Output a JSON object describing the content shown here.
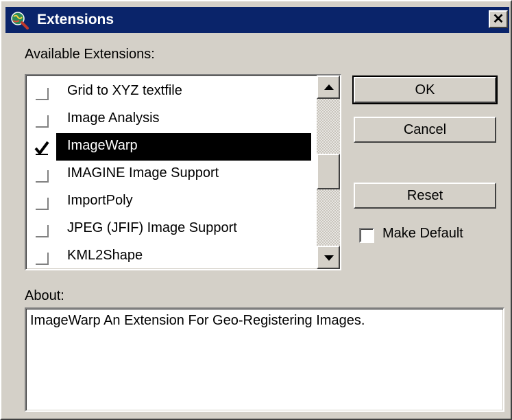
{
  "window": {
    "title": "Extensions",
    "close_label": "✕"
  },
  "available_label": "Available Extensions:",
  "extensions": [
    {
      "label": "Grid to XYZ textfile",
      "checked": false
    },
    {
      "label": "Image Analysis",
      "checked": false
    },
    {
      "label": "ImageWarp",
      "checked": true,
      "selected": true
    },
    {
      "label": "IMAGINE Image Support",
      "checked": false
    },
    {
      "label": "ImportPoly",
      "checked": false
    },
    {
      "label": "JPEG (JFIF) Image Support",
      "checked": false
    },
    {
      "label": "KML2Shape",
      "checked": false
    }
  ],
  "buttons": {
    "ok": "OK",
    "cancel": "Cancel",
    "reset": "Reset"
  },
  "make_default": {
    "label": "Make Default",
    "checked": false
  },
  "about": {
    "label": "About:",
    "text": "ImageWarp An Extension For Geo-Registering Images."
  },
  "colors": {
    "titlebar": "#0a246a",
    "face": "#d4d0c8",
    "selection": "#000000"
  }
}
